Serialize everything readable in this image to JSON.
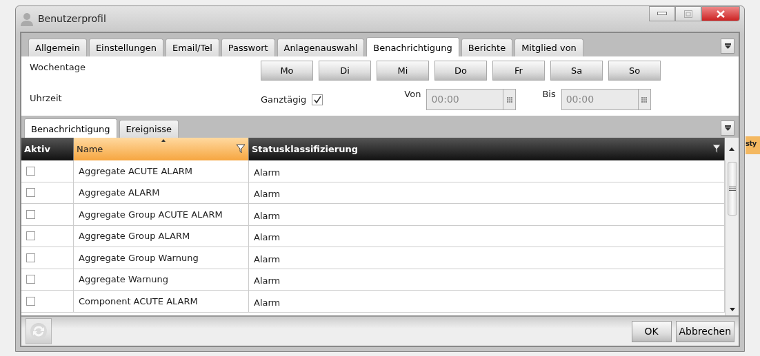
{
  "window": {
    "title": "Benutzerprofil"
  },
  "tabs": [
    {
      "label": "Allgemein",
      "selected": false
    },
    {
      "label": "Einstellungen",
      "selected": false
    },
    {
      "label": "Email/Tel",
      "selected": false
    },
    {
      "label": "Passwort",
      "selected": false
    },
    {
      "label": "Anlagenauswahl",
      "selected": false
    },
    {
      "label": "Benachrichtigung",
      "selected": true
    },
    {
      "label": "Berichte",
      "selected": false
    },
    {
      "label": "Mitglied von",
      "selected": false
    }
  ],
  "weekdays": {
    "label": "Wochentage",
    "days": [
      "Mo",
      "Di",
      "Mi",
      "Do",
      "Fr",
      "Sa",
      "So"
    ]
  },
  "time": {
    "label": "Uhrzeit",
    "all_day": {
      "label": "Ganztägig",
      "checked": true
    },
    "from": {
      "label": "Von",
      "value": "00:00",
      "disabled": true
    },
    "to": {
      "label": "Bis",
      "value": "00:00",
      "disabled": true
    }
  },
  "subtabs": [
    {
      "label": "Benachrichtigung",
      "selected": true
    },
    {
      "label": "Ereignisse",
      "selected": false
    }
  ],
  "table": {
    "columns": [
      {
        "label": "Aktiv",
        "sorted": false,
        "filter": false
      },
      {
        "label": "Name",
        "sorted": true,
        "filter": true
      },
      {
        "label": "Statusklassifizierung",
        "sorted": false,
        "filter": true
      }
    ],
    "rows": [
      {
        "active": false,
        "name": "Aggregate ACUTE ALARM",
        "status": "Alarm"
      },
      {
        "active": false,
        "name": "Aggregate ALARM",
        "status": "Alarm"
      },
      {
        "active": false,
        "name": "Aggregate Group ACUTE ALARM",
        "status": "Alarm"
      },
      {
        "active": false,
        "name": "Aggregate Group ALARM",
        "status": "Alarm"
      },
      {
        "active": false,
        "name": "Aggregate Group Warnung",
        "status": "Alarm"
      },
      {
        "active": false,
        "name": "Aggregate Warnung",
        "status": "Alarm"
      },
      {
        "active": false,
        "name": "Component ACUTE ALARM",
        "status": "Alarm"
      }
    ]
  },
  "buttons": [
    "OK",
    "Abbrechen"
  ],
  "background_window": {
    "text": "sty"
  }
}
